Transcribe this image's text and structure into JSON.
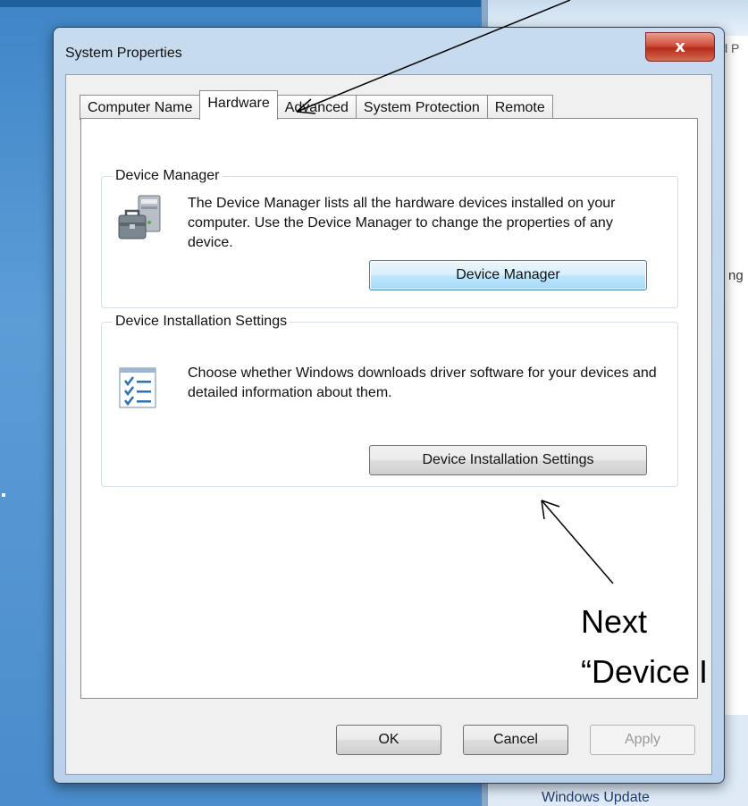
{
  "background": {
    "right_peek_text": "l P",
    "right_peek_text2": "ng",
    "windows_update_link": "Windows Update"
  },
  "dialog": {
    "title": "System Properties",
    "close_glyph": "x",
    "tabs": [
      {
        "label": "Computer Name",
        "active": false
      },
      {
        "label": "Hardware",
        "active": true
      },
      {
        "label": "Advanced",
        "active": false
      },
      {
        "label": "System Protection",
        "active": false
      },
      {
        "label": "Remote",
        "active": false
      }
    ],
    "device_manager": {
      "legend": "Device Manager",
      "description": "The Device Manager lists all the hardware devices installed on your computer. Use the Device Manager to change the properties of any device.",
      "button_label": "Device Manager",
      "icon": "device-manager-icon"
    },
    "device_installation": {
      "legend": "Device Installation Settings",
      "description": "Choose whether Windows downloads driver software for your devices and detailed information about them.",
      "button_label": "Device Installation Settings",
      "icon": "checklist-icon"
    },
    "footer": {
      "ok_label": "OK",
      "cancel_label": "Cancel",
      "apply_label": "Apply"
    }
  },
  "annotations": {
    "line1": "Next",
    "line2": "“Device I"
  },
  "colors": {
    "desktop_blue": "#4a8ccc",
    "close_red": "#c8402a",
    "focus_blue": "#3c7fb1"
  }
}
